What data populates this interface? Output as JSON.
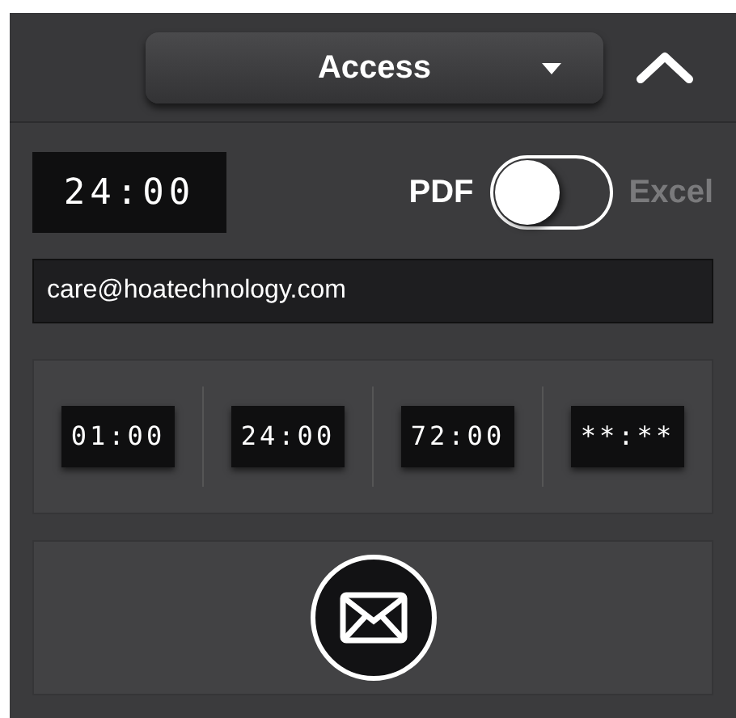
{
  "header": {
    "dropdown": {
      "label": "Access",
      "expanded": false
    }
  },
  "timer": {
    "display": "24:00"
  },
  "formats": [
    {
      "label": "PDF",
      "selected": true
    },
    {
      "label": "Excel",
      "selected": false
    }
  ],
  "email_field": {
    "value": "care@hoatechnology.com"
  },
  "presets": [
    {
      "label": "01:00"
    },
    {
      "label": "24:00"
    },
    {
      "label": "72:00"
    },
    {
      "label": "**:**"
    }
  ]
}
